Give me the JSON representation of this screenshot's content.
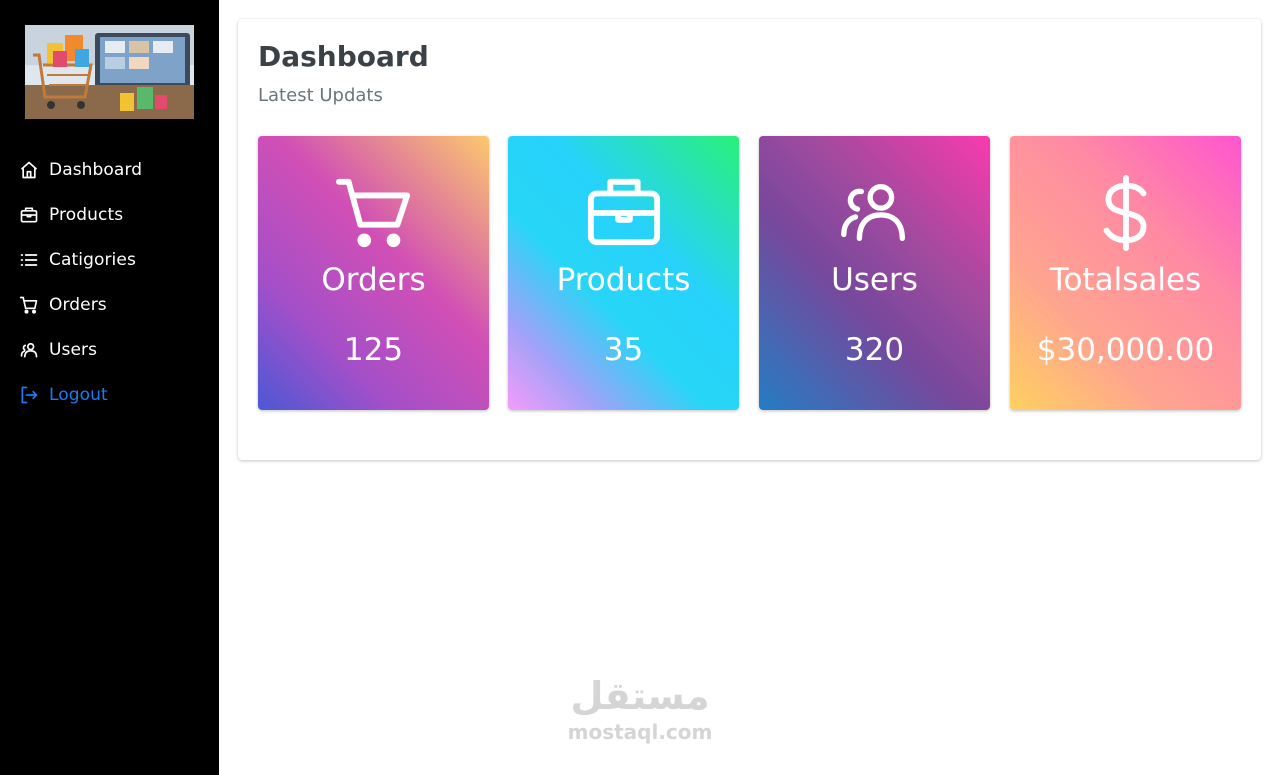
{
  "sidebar": {
    "logo_icon": "shopping-cart-image",
    "items": [
      {
        "label": "Dashboard",
        "icon": "home-icon"
      },
      {
        "label": "Products",
        "icon": "briefcase-icon"
      },
      {
        "label": "Catigories",
        "icon": "list-icon"
      },
      {
        "label": "Orders",
        "icon": "cart-icon"
      },
      {
        "label": "Users",
        "icon": "users-icon"
      },
      {
        "label": "Logout",
        "icon": "logout-icon",
        "color": "#1a7cf5"
      }
    ]
  },
  "main": {
    "title": "Dashboard",
    "subtitle": "Latest Updats",
    "cards": [
      {
        "label": "Orders",
        "value": "125",
        "icon": "cart-icon"
      },
      {
        "label": "Products",
        "value": "35",
        "icon": "briefcase-icon"
      },
      {
        "label": "Users",
        "value": "320",
        "icon": "users-icon"
      },
      {
        "label": "Totalsales",
        "value": "$30,000.00",
        "icon": "dollar-icon"
      }
    ]
  },
  "watermark": {
    "arabic": "مستقل",
    "domain": "mostaql.com"
  },
  "colors": {
    "sidebar_bg": "#000000",
    "logout": "#1a7cf5",
    "title": "#3b4247",
    "subtitle": "#6c757d"
  }
}
